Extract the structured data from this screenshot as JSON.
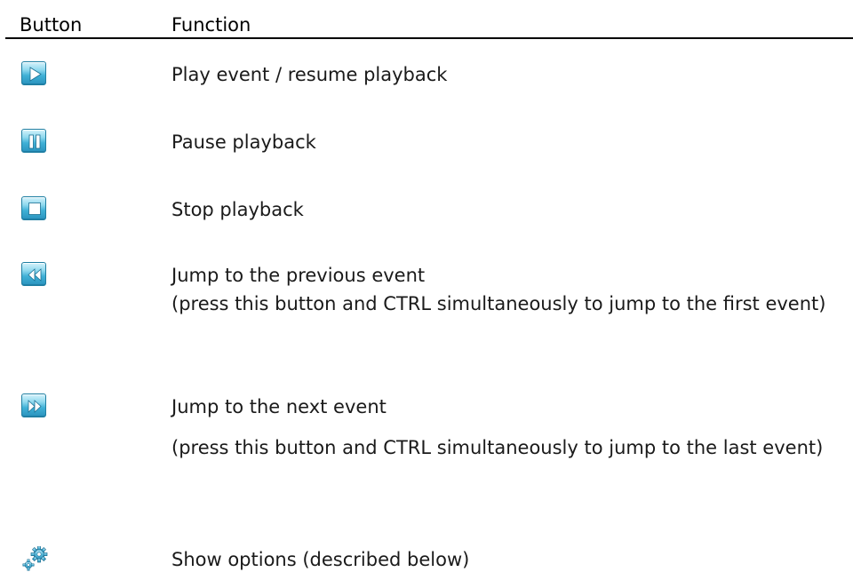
{
  "header": {
    "button_col": "Button",
    "function_col": "Function"
  },
  "rows": [
    {
      "icon": "play-icon",
      "text": "Play event / resume playback"
    },
    {
      "icon": "pause-icon",
      "text": "Pause playback"
    },
    {
      "icon": "stop-icon",
      "text": "Stop playback"
    },
    {
      "icon": "previous-event-icon",
      "text": "Jump to the previous event",
      "note": "(press this button and CTRL simultaneously to jump to the first event)"
    },
    {
      "icon": "next-event-icon",
      "text": "Jump to the next event",
      "note": "(press this button and CTRL simultaneously to jump to the last event)"
    },
    {
      "icon": "options-gear-icon",
      "text": "Show options (described below)"
    }
  ],
  "colors": {
    "icon_blue_light": "#d6f2fb",
    "icon_blue_dark": "#2a92bd",
    "rule": "#000000"
  }
}
